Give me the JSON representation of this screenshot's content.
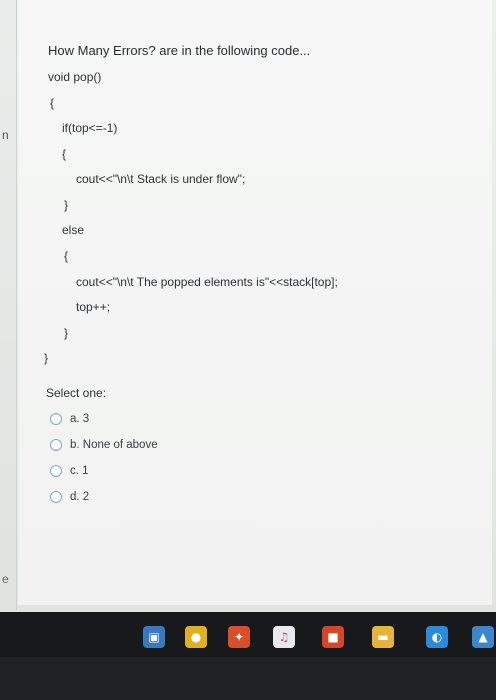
{
  "question": {
    "title": "How Many Errors? are in the following code...",
    "code_lines": [
      "void pop()",
      "{",
      "if(top<=-1)",
      "{",
      "cout<<\"\\n\\t Stack is under flow\";",
      "}",
      "else",
      "{",
      "cout<<\"\\n\\t The popped elements is\"<<stack[top];",
      "top++;",
      "}",
      "}"
    ]
  },
  "answers": {
    "prompt": "Select one:",
    "options": [
      {
        "label": "a. 3"
      },
      {
        "label": "b. None of above"
      },
      {
        "label": "c. 1"
      },
      {
        "label": "d. 2"
      }
    ]
  },
  "edge_fragments": {
    "top": "n",
    "bottom": "e"
  },
  "taskbar": {
    "icons": [
      {
        "name": "store-icon",
        "color": "#3a78c2",
        "glyph": "▣"
      },
      {
        "name": "chrome-icon",
        "color": "#e0b020",
        "glyph": "●"
      },
      {
        "name": "sparkle-app-icon",
        "color": "#d74f2b",
        "glyph": "✦"
      },
      {
        "name": "itunes-icon",
        "color": "#e9e9ee",
        "glyph": "♫"
      },
      {
        "name": "office-icon",
        "color": "#d24726",
        "glyph": "■"
      },
      {
        "name": "file-explorer-icon",
        "color": "#e8b33c",
        "glyph": "▬"
      },
      {
        "name": "edge-icon",
        "color": "#2b8ad9",
        "glyph": "◐"
      },
      {
        "name": "photos-icon",
        "color": "#3c87c9",
        "glyph": "▲"
      }
    ]
  }
}
